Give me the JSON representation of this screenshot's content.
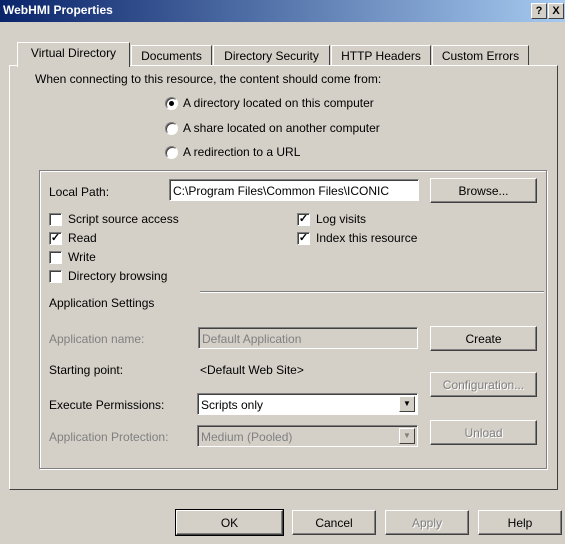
{
  "window": {
    "title": "WebHMI Properties",
    "help_glyph": "?",
    "close_glyph": "X"
  },
  "tabs": [
    "Virtual Directory",
    "Documents",
    "Directory Security",
    "HTTP Headers",
    "Custom Errors"
  ],
  "intro_text": "When connecting to this resource, the content should come from:",
  "content_source": {
    "options": [
      "A directory located on this computer",
      "A share located on another computer",
      "A redirection to a URL"
    ],
    "selected_index": 0
  },
  "local_path": {
    "label": "Local Path:",
    "value": "C:\\Program Files\\Common Files\\ICONIC",
    "browse_label": "Browse..."
  },
  "permissions_left": [
    {
      "label": "Script source access",
      "checked": false
    },
    {
      "label": "Read",
      "checked": true
    },
    {
      "label": "Write",
      "checked": false
    },
    {
      "label": "Directory browsing",
      "checked": false
    }
  ],
  "permissions_right": [
    {
      "label": "Log visits",
      "checked": true
    },
    {
      "label": "Index this resource",
      "checked": true
    }
  ],
  "app_settings": {
    "heading": "Application Settings",
    "app_name_label": "Application name:",
    "app_name_value": "Default Application",
    "create_label": "Create",
    "starting_point_label": "Starting point:",
    "starting_point_value": "<Default Web Site>",
    "configuration_label": "Configuration...",
    "exec_perm_label": "Execute Permissions:",
    "exec_perm_value": "Scripts only",
    "app_protection_label": "Application Protection:",
    "app_protection_value": "Medium (Pooled)",
    "unload_label": "Unload"
  },
  "footer": {
    "ok": "OK",
    "cancel": "Cancel",
    "apply": "Apply",
    "help": "Help"
  },
  "colors": {
    "face": "#d4d0c8",
    "title_start": "#0a246a",
    "title_end": "#a6caf0",
    "disabled_text": "#808080"
  }
}
